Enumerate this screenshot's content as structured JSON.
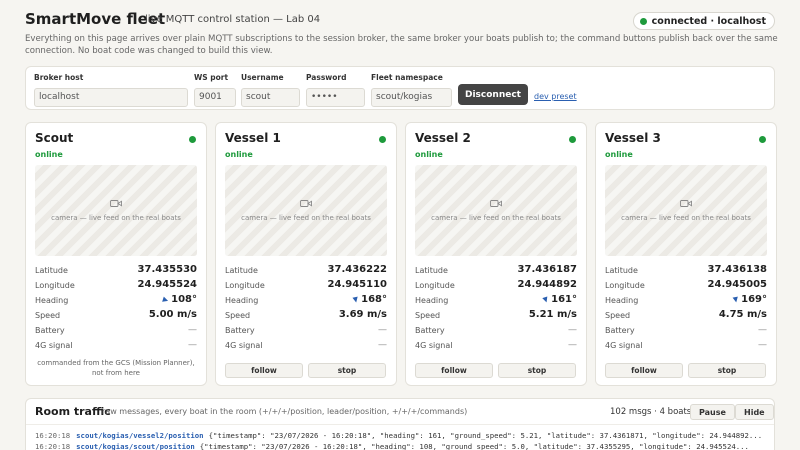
{
  "header": {
    "title": "SmartMove fleet",
    "subtitle": "live MQTT control station — Lab 04",
    "connection_status": "connected · localhost",
    "status_color": "#1e9a3c",
    "description": "Everything on this page arrives over plain MQTT subscriptions to the session broker, the same broker your boats publish to; the command buttons publish back over the same connection. No boat code was changed to build this view."
  },
  "connection": {
    "broker_host_label": "Broker host",
    "broker_host_value": "localhost",
    "ws_port_label": "WS port",
    "ws_port_value": "9001",
    "username_label": "Username",
    "username_value": "scout",
    "password_label": "Password",
    "password_value": "•••••",
    "namespace_label": "Fleet namespace",
    "namespace_value": "scout/kogias",
    "disconnect_label": "Disconnect",
    "preset_label": "dev preset"
  },
  "labels": {
    "latitude": "Latitude",
    "longitude": "Longitude",
    "heading": "Heading",
    "speed": "Speed",
    "battery": "Battery",
    "signal": "4G signal",
    "camera": "camera — live feed on the real boats",
    "follow": "follow",
    "stop": "stop",
    "dash": "—"
  },
  "boats": [
    {
      "name": "Scout",
      "status": "online",
      "latitude": "37.435530",
      "longitude": "24.945524",
      "heading": "108°",
      "speed": "5.00 m/s",
      "battery": "—",
      "signal": "—",
      "note": "commanded from the GCS (Mission Planner), not from here"
    },
    {
      "name": "Vessel 1",
      "status": "online",
      "latitude": "37.436222",
      "longitude": "24.945110",
      "heading": "168°",
      "speed": "3.69 m/s",
      "battery": "—",
      "signal": "—"
    },
    {
      "name": "Vessel 2",
      "status": "online",
      "latitude": "37.436187",
      "longitude": "24.944892",
      "heading": "161°",
      "speed": "5.21 m/s",
      "battery": "—",
      "signal": "—"
    },
    {
      "name": "Vessel 3",
      "status": "online",
      "latitude": "37.436138",
      "longitude": "24.945005",
      "heading": "169°",
      "speed": "4.75 m/s",
      "battery": "—",
      "signal": "—"
    }
  ],
  "traffic": {
    "title": "Room traffic",
    "subtitle": "raw messages, every boat in the room (+/+/+/position, leader/position, +/+/+/commands)",
    "count": "102 msgs · 4 boats",
    "pause_label": "Pause",
    "hide_label": "Hide",
    "lines": [
      {
        "time": "16:20:18",
        "topic": "scout/kogias/vessel2/position",
        "payload": "{\"timestamp\": \"23/07/2026 - 16:20:18\", \"heading\": 161, \"ground_speed\": 5.21, \"latitude\": 37.4361871, \"longitude\": 24.944892..."
      },
      {
        "time": "16:20:18",
        "topic": "scout/kogias/scout/position",
        "payload": "{\"timestamp\": \"23/07/2026 - 16:20:18\", \"heading\": 108, \"ground_speed\": 5.0, \"latitude\": 37.4355295, \"longitude\": 24.945524..."
      }
    ]
  }
}
